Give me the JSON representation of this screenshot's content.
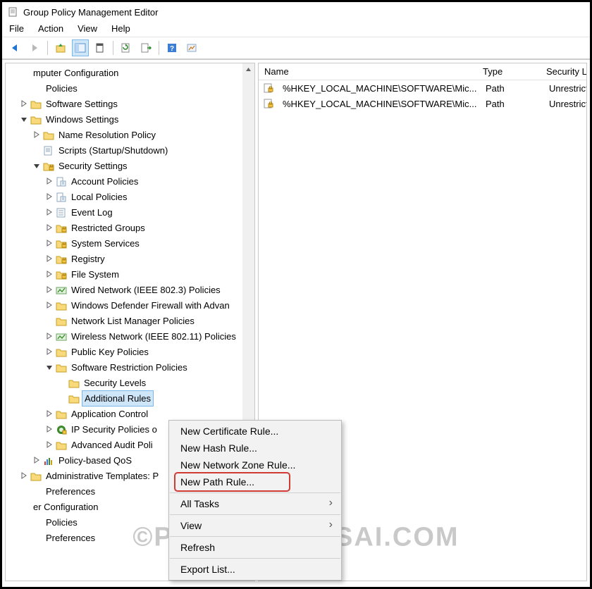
{
  "window": {
    "title": "Group Policy Management Editor"
  },
  "menubar": [
    "File",
    "Action",
    "View",
    "Help"
  ],
  "tree": [
    {
      "indent": 0,
      "exp": "none",
      "icon": "none",
      "label": "mputer Configuration"
    },
    {
      "indent": 1,
      "exp": "none",
      "icon": "none",
      "label": "Policies"
    },
    {
      "indent": 1,
      "exp": "closed",
      "icon": "folder",
      "label": "Software Settings"
    },
    {
      "indent": 1,
      "exp": "open",
      "icon": "folder",
      "label": "Windows Settings"
    },
    {
      "indent": 2,
      "exp": "closed",
      "icon": "folder",
      "label": "Name Resolution Policy"
    },
    {
      "indent": 2,
      "exp": "none",
      "icon": "script",
      "label": "Scripts (Startup/Shutdown)"
    },
    {
      "indent": 2,
      "exp": "open",
      "icon": "folder-lock",
      "label": "Security Settings"
    },
    {
      "indent": 3,
      "exp": "closed",
      "icon": "policy",
      "label": "Account Policies"
    },
    {
      "indent": 3,
      "exp": "closed",
      "icon": "policy",
      "label": "Local Policies"
    },
    {
      "indent": 3,
      "exp": "closed",
      "icon": "log",
      "label": "Event Log"
    },
    {
      "indent": 3,
      "exp": "closed",
      "icon": "folder-lock",
      "label": "Restricted Groups"
    },
    {
      "indent": 3,
      "exp": "closed",
      "icon": "folder-lock",
      "label": "System Services"
    },
    {
      "indent": 3,
      "exp": "closed",
      "icon": "folder-lock",
      "label": "Registry"
    },
    {
      "indent": 3,
      "exp": "closed",
      "icon": "folder-lock",
      "label": "File System"
    },
    {
      "indent": 3,
      "exp": "closed",
      "icon": "net",
      "label": "Wired Network (IEEE 802.3) Policies"
    },
    {
      "indent": 3,
      "exp": "closed",
      "icon": "folder",
      "label": "Windows Defender Firewall with Advan"
    },
    {
      "indent": 3,
      "exp": "none",
      "icon": "folder",
      "label": "Network List Manager Policies"
    },
    {
      "indent": 3,
      "exp": "closed",
      "icon": "net",
      "label": "Wireless Network (IEEE 802.11) Policies"
    },
    {
      "indent": 3,
      "exp": "closed",
      "icon": "folder",
      "label": "Public Key Policies"
    },
    {
      "indent": 3,
      "exp": "open",
      "icon": "folder",
      "label": "Software Restriction Policies"
    },
    {
      "indent": 4,
      "exp": "none",
      "icon": "folder",
      "label": "Security Levels"
    },
    {
      "indent": 4,
      "exp": "none",
      "icon": "folder",
      "label": "Additional Rules",
      "selected": true
    },
    {
      "indent": 3,
      "exp": "closed",
      "icon": "folder",
      "label": "Application Control "
    },
    {
      "indent": 3,
      "exp": "closed",
      "icon": "ipsec",
      "label": "IP Security Policies o"
    },
    {
      "indent": 3,
      "exp": "closed",
      "icon": "folder",
      "label": "Advanced Audit Poli"
    },
    {
      "indent": 2,
      "exp": "closed",
      "icon": "qos",
      "label": "Policy-based QoS"
    },
    {
      "indent": 1,
      "exp": "closed",
      "icon": "folder",
      "label": "Administrative Templates: P"
    },
    {
      "indent": 1,
      "exp": "none",
      "icon": "none",
      "label": "Preferences"
    },
    {
      "indent": 0,
      "exp": "none",
      "icon": "none",
      "label": "er Configuration"
    },
    {
      "indent": 1,
      "exp": "none",
      "icon": "none",
      "label": "Policies"
    },
    {
      "indent": 1,
      "exp": "none",
      "icon": "none",
      "label": "Preferences"
    }
  ],
  "list": {
    "columns": [
      "Name",
      "Type",
      "Security Le"
    ],
    "rows": [
      {
        "name": "%HKEY_LOCAL_MACHINE\\SOFTWARE\\Mic...",
        "type": "Path",
        "security": "Unrestricte"
      },
      {
        "name": "%HKEY_LOCAL_MACHINE\\SOFTWARE\\Mic...",
        "type": "Path",
        "security": "Unrestricte"
      }
    ]
  },
  "context_menu": [
    {
      "label": "New Certificate Rule..."
    },
    {
      "label": "New Hash Rule..."
    },
    {
      "label": "New Network Zone Rule..."
    },
    {
      "label": "New Path Rule...",
      "highlighted": true
    },
    {
      "sep": true
    },
    {
      "label": "All Tasks",
      "submenu": true
    },
    {
      "sep": true
    },
    {
      "label": "View",
      "submenu": true
    },
    {
      "sep": true
    },
    {
      "label": "Refresh"
    },
    {
      "sep": true
    },
    {
      "label": "Export List..."
    }
  ],
  "watermark": "©PRAJWALDESAI.COM"
}
